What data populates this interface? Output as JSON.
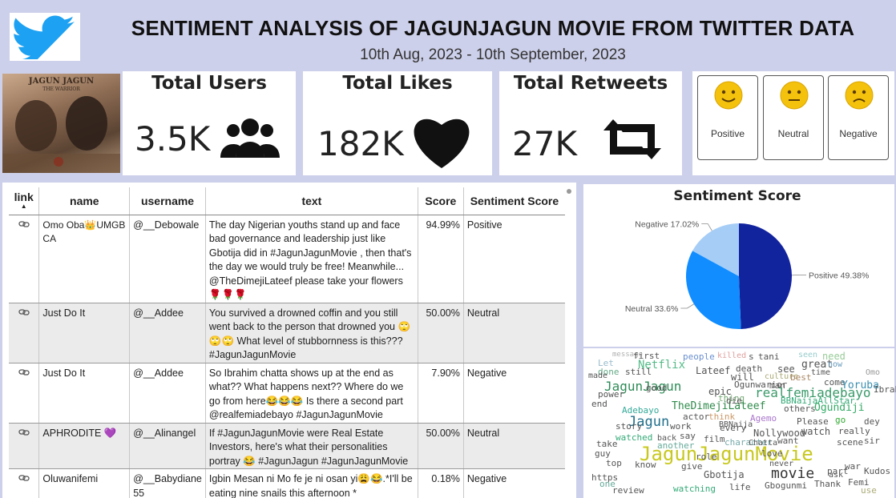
{
  "header": {
    "title": "SENTIMENT ANALYSIS OF JAGUNJAGUN MOVIE FROM TWITTER DATA",
    "date_range": "10th Aug, 2023 - 10th September, 2023",
    "logo_icon": "twitter-bird-icon"
  },
  "poster": {
    "title_line1": "JAGUN JAGUN",
    "title_line2": "THE WARRIOR"
  },
  "kpis": {
    "users": {
      "label": "Total Users",
      "value": "3.5K",
      "icon": "users-icon"
    },
    "likes": {
      "label": "Total Likes",
      "value": "182K",
      "icon": "heart-icon"
    },
    "retweets": {
      "label": "Total Retweets",
      "value": "27K",
      "icon": "retweet-icon"
    }
  },
  "sentiment_buttons": [
    {
      "label": "Positive",
      "icon": "smile-emoji-icon"
    },
    {
      "label": "Neutral",
      "icon": "neutral-emoji-icon"
    },
    {
      "label": "Negative",
      "icon": "sad-emoji-icon"
    }
  ],
  "table": {
    "columns": [
      "link",
      "name",
      "username",
      "text",
      "Score",
      "Sentiment Score"
    ],
    "rows": [
      {
        "name": "Omo Oba👑UMGB CA",
        "username": "@__Debowale",
        "text": "The day Nigerian youths stand up and face bad governance and leadership just like Gbotija did in #JagunJagunMovie , then that's the day we would truly be free! Meanwhile... @TheDimejiLateef please take your flowers 🌹🌹🌹",
        "score": "94.99%",
        "sentiment": "Positive"
      },
      {
        "name": "Just Do It",
        "username": "@__Addee",
        "text": "You survived a drowned coffin and you still went back to the person that drowned you 🙄🙄🙄 What level of stubbornness is this??? #JagunJagunMovie",
        "score": "50.00%",
        "sentiment": "Neutral"
      },
      {
        "name": "Just Do It",
        "username": "@__Addee",
        "text": "So Ibrahim chatta shows up at the end as what?? What happens next?? Where do we go from here😂😂😂 Is there a second part @realfemiadebayo #JagunJagunMovie",
        "score": "7.90%",
        "sentiment": "Negative"
      },
      {
        "name": "APHRODITE 💜",
        "username": "@__Alinangel",
        "text": "If #JagunJagunMovie were Real Estate Investors, here's what their personalities portray 😂 #JagunJagun #JagunJagunMovie",
        "score": "50.00%",
        "sentiment": "Neutral"
      },
      {
        "name": "Oluwanifemi",
        "username": "@__Babydiane 55",
        "text": "Igbin Mesan ni Mo fe je ni osan yi😩😂.*I'll be eating nine snails this afternoon *",
        "score": "0.18%",
        "sentiment": "Negative"
      }
    ]
  },
  "chart_data": {
    "type": "pie",
    "title": "Sentiment Score",
    "labels": [
      "Positive",
      "Neutral",
      "Negative"
    ],
    "values": [
      49.38,
      33.6,
      17.02
    ],
    "label_texts": [
      "Positive 49.38%",
      "Neutral 33.6%",
      "Negative 17.02%"
    ],
    "colors": [
      "#12239e",
      "#118dff",
      "#a5cdf6"
    ]
  },
  "wordcloud": {
    "words": [
      {
        "t": "message",
        "c": "#b0b0b0"
      },
      {
        "t": "first",
        "c": "#555"
      },
      {
        "t": "people",
        "c": "#6a8fd0"
      },
      {
        "t": "killed",
        "c": "#e0a0a0"
      },
      {
        "t": "s",
        "c": "#555"
      },
      {
        "t": "tani",
        "c": "#555"
      },
      {
        "t": "seen",
        "c": "#9cc"
      },
      {
        "t": "need",
        "c": "#9c9"
      },
      {
        "t": "Let",
        "c": "#9bc"
      },
      {
        "t": "Netflix",
        "c": "#5b8"
      },
      {
        "t": "great",
        "c": "#555"
      },
      {
        "t": "now",
        "c": "#69b"
      },
      {
        "t": "done",
        "c": "#6a8"
      },
      {
        "t": "still",
        "c": "#555"
      },
      {
        "t": "Lateef",
        "c": "#555"
      },
      {
        "t": "death",
        "c": "#555"
      },
      {
        "t": "see",
        "c": "#555"
      },
      {
        "t": "time",
        "c": "#555"
      },
      {
        "t": "Omo",
        "c": "#999"
      },
      {
        "t": "JagunJagun",
        "c": "#2e8b57"
      },
      {
        "t": "will",
        "c": "#555"
      },
      {
        "t": "culture",
        "c": "#aa7"
      },
      {
        "t": "best",
        "c": "#a86"
      },
      {
        "t": "come",
        "c": "#555"
      },
      {
        "t": "Ogunwarior",
        "c": "#555"
      },
      {
        "t": "man",
        "c": "#555"
      },
      {
        "t": "Yoruba",
        "c": "#3a8fb0"
      },
      {
        "t": "epic",
        "c": "#555"
      },
      {
        "t": "realfemiadebayo",
        "c": "#3a9a6a"
      },
      {
        "t": "Ibrahim",
        "c": "#555"
      },
      {
        "t": "thing",
        "c": "#7a7"
      },
      {
        "t": "BBNaijaAllStar",
        "c": "#3a7"
      },
      {
        "t": "TheDimejiLateef",
        "c": "#2e8a4a"
      },
      {
        "t": "Ogundiji",
        "c": "#3a6"
      },
      {
        "t": "Jagun",
        "c": "#1f6f8b"
      },
      {
        "t": "Adebayo",
        "c": "#3a9"
      },
      {
        "t": "Please",
        "c": "#555"
      },
      {
        "t": "go",
        "c": "#3a3"
      },
      {
        "t": "dey",
        "c": "#555"
      },
      {
        "t": "actor",
        "c": "#555"
      },
      {
        "t": "think",
        "c": "#c96"
      },
      {
        "t": "Agemo",
        "c": "#a7c"
      },
      {
        "t": "watch",
        "c": "#555"
      },
      {
        "t": "really",
        "c": "#555"
      },
      {
        "t": "Nollywood",
        "c": "#555"
      },
      {
        "t": "sir",
        "c": "#555"
      },
      {
        "t": "watched",
        "c": "#3a7"
      },
      {
        "t": "back",
        "c": "#555"
      },
      {
        "t": "say",
        "c": "#555"
      },
      {
        "t": "film",
        "c": "#555"
      },
      {
        "t": "want",
        "c": "#555"
      },
      {
        "t": "scene",
        "c": "#555"
      },
      {
        "t": "another",
        "c": "#6a9"
      },
      {
        "t": "character",
        "c": "#7aa"
      },
      {
        "t": "JagunJagunMovie",
        "c": "#c8c820"
      },
      {
        "t": "Gbotija",
        "c": "#555"
      },
      {
        "t": "movie",
        "c": "#333"
      },
      {
        "t": "part",
        "c": "#555"
      },
      {
        "t": "Kudos",
        "c": "#555"
      },
      {
        "t": "https",
        "c": "#555"
      },
      {
        "t": "Gbogunmi",
        "c": "#555"
      },
      {
        "t": "Thank",
        "c": "#555"
      },
      {
        "t": "Femi",
        "c": "#555"
      },
      {
        "t": "use",
        "c": "#aa7"
      },
      {
        "t": "review",
        "c": "#555"
      },
      {
        "t": "watching",
        "c": "#3a7"
      },
      {
        "t": "life",
        "c": "#555"
      },
      {
        "t": "ask",
        "c": "#555"
      },
      {
        "t": "good",
        "c": "#555"
      },
      {
        "t": "story",
        "c": "#555"
      },
      {
        "t": "take",
        "c": "#555"
      },
      {
        "t": "guy",
        "c": "#555"
      },
      {
        "t": "top",
        "c": "#555"
      },
      {
        "t": "one",
        "c": "#6a9"
      },
      {
        "t": "end",
        "c": "#555"
      },
      {
        "t": "work",
        "c": "#555"
      },
      {
        "t": "role",
        "c": "#555"
      },
      {
        "t": "give",
        "c": "#555"
      },
      {
        "t": "know",
        "c": "#555"
      },
      {
        "t": "every",
        "c": "#555"
      },
      {
        "t": "made",
        "c": "#555"
      },
      {
        "t": "power",
        "c": "#555"
      },
      {
        "t": "die",
        "c": "#555"
      },
      {
        "t": "others",
        "c": "#555"
      },
      {
        "t": "love",
        "c": "#555"
      },
      {
        "t": "war",
        "c": "#555"
      },
      {
        "t": "never",
        "c": "#555"
      },
      {
        "t": "BBNaija",
        "c": "#555"
      },
      {
        "t": "Chatta",
        "c": "#555"
      }
    ]
  }
}
